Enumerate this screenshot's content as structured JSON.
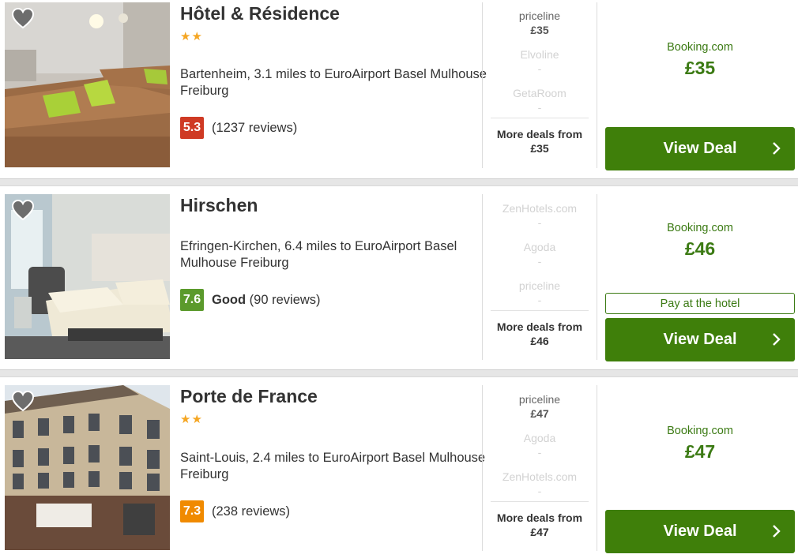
{
  "hotels": [
    {
      "name": "Hôtel & Résidence",
      "stars": "★★",
      "location": "Bartenheim, 3.1 miles to EuroAirport Basel Mulhouse Freiburg",
      "score": "5.3",
      "score_color": "#cf3a24",
      "rating_word": "",
      "reviews": "(1237 reviews)",
      "deals": [
        {
          "provider": "priceline",
          "price": "£35"
        },
        {
          "provider": "Elvoline",
          "price": "-"
        },
        {
          "provider": "GetaRoom",
          "price": "-"
        }
      ],
      "more_deals_label": "More deals from",
      "more_deals_price": "£35",
      "best_site": "Booking.com",
      "best_price": "£35",
      "pay_at_hotel": "",
      "cta_label": "View Deal"
    },
    {
      "name": "Hirschen",
      "stars": "",
      "location": "Efringen-Kirchen, 6.4 miles to EuroAirport Basel Mulhouse Freiburg",
      "score": "7.6",
      "score_color": "#5b9a2c",
      "rating_word": "Good",
      "reviews": "(90 reviews)",
      "deals": [
        {
          "provider": "ZenHotels.com",
          "price": "-"
        },
        {
          "provider": "Agoda",
          "price": "-"
        },
        {
          "provider": "priceline",
          "price": "-"
        }
      ],
      "more_deals_label": "More deals from",
      "more_deals_price": "£46",
      "best_site": "Booking.com",
      "best_price": "£46",
      "pay_at_hotel": "Pay at the hotel",
      "cta_label": "View Deal"
    },
    {
      "name": "Porte de France",
      "stars": "★★",
      "location": "Saint-Louis, 2.4 miles to EuroAirport Basel Mulhouse Freiburg",
      "score": "7.3",
      "score_color": "#f08a00",
      "rating_word": "",
      "reviews": "(238 reviews)",
      "deals": [
        {
          "provider": "priceline",
          "price": "£47"
        },
        {
          "provider": "Agoda",
          "price": "-"
        },
        {
          "provider": "ZenHotels.com",
          "price": "-"
        }
      ],
      "more_deals_label": "More deals from",
      "more_deals_price": "£47",
      "best_site": "Booking.com",
      "best_price": "£47",
      "pay_at_hotel": "",
      "cta_label": "View Deal"
    }
  ],
  "icons": {
    "favorite": "heart-icon",
    "cta": "chevron-right-icon"
  },
  "colors": {
    "accent_green": "#3f7f0a",
    "price_green": "#3b7a13",
    "star_gold": "#f5a623"
  }
}
